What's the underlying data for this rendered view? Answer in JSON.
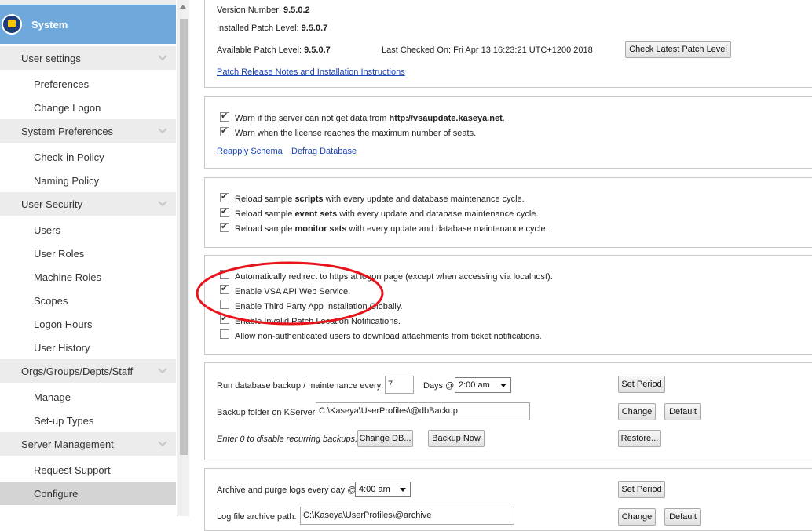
{
  "sidebar": {
    "title": "System",
    "sections": [
      {
        "label": "User settings",
        "items": [
          "Preferences",
          "Change Logon"
        ]
      },
      {
        "label": "System Preferences",
        "items": [
          "Check-in Policy",
          "Naming Policy"
        ]
      },
      {
        "label": "User Security",
        "items": [
          "Users",
          "User Roles",
          "Machine Roles",
          "Scopes",
          "Logon Hours",
          "User History"
        ]
      },
      {
        "label": "Orgs/Groups/Depts/Staff",
        "items": [
          "Manage",
          "Set-up Types"
        ]
      },
      {
        "label": "Server Management",
        "items": [
          "Request Support",
          "Configure"
        ]
      }
    ],
    "active_item": "Configure"
  },
  "version": {
    "version_label": "Version Number:",
    "version_value": "9.5.0.2",
    "installed_label": "Installed Patch Level:",
    "installed_value": "9.5.0.7",
    "available_label": "Available Patch Level:",
    "available_value": "9.5.0.7",
    "last_checked_label": "Last Checked On:",
    "last_checked_value": "Fri Apr 13 16:23:21 UTC+1200 2018",
    "check_button": "Check Latest Patch Level",
    "release_notes_link": "Patch Release Notes and Installation Instructions"
  },
  "warnings": {
    "warn1_prefix": "Warn if the server can not get data from ",
    "warn1_bold": "http://vsaupdate.kaseya.net",
    "warn1_suffix": ".",
    "warn1_checked": true,
    "warn2": "Warn when the license reaches the maximum number of seats.",
    "warn2_checked": true,
    "reapply_link": "Reapply Schema",
    "defrag_link": "Defrag Database"
  },
  "reload": {
    "items": [
      {
        "prefix": "Reload sample ",
        "bold": "scripts",
        "suffix": " with every update and database maintenance cycle.",
        "checked": true
      },
      {
        "prefix": "Reload sample ",
        "bold": "event sets",
        "suffix": " with every update and database maintenance cycle.",
        "checked": true
      },
      {
        "prefix": "Reload sample ",
        "bold": "monitor sets",
        "suffix": " with every update and database maintenance cycle.",
        "checked": true
      }
    ]
  },
  "options": {
    "items": [
      {
        "label": "Automatically redirect to https at logon page (except when accessing via localhost).",
        "checked": false
      },
      {
        "label": "Enable VSA API Web Service.",
        "checked": true
      },
      {
        "label": "Enable Third Party App Installation Globally.",
        "checked": false
      },
      {
        "label": "Enable Invalid Patch Location Notifications.",
        "checked": true
      },
      {
        "label": "Allow non-authenticated users to download attachments from ticket notifications.",
        "checked": false
      }
    ],
    "highlight_color": "#e8141c"
  },
  "backup": {
    "run_label": "Run database backup / maintenance every:",
    "run_value": "7",
    "days_label": "Days @",
    "time_value": "2:00 am",
    "set_period_button": "Set Period",
    "folder_label": "Backup folder on KServer",
    "folder_value": "C:\\Kaseya\\UserProfiles\\@dbBackup",
    "change_button": "Change",
    "default_button": "Default",
    "hint": "Enter 0 to disable recurring backups.",
    "change_db_button": "Change DB...",
    "backup_now_button": "Backup Now",
    "restore_button": "Restore..."
  },
  "archive": {
    "archive_label": "Archive and purge logs every day @",
    "time_value": "4:00 am",
    "set_period_button": "Set Period",
    "log_path_label": "Log file archive path:",
    "log_path_value": "C:\\Kaseya\\UserProfiles\\@archive",
    "change_button": "Change",
    "default_button": "Default"
  }
}
